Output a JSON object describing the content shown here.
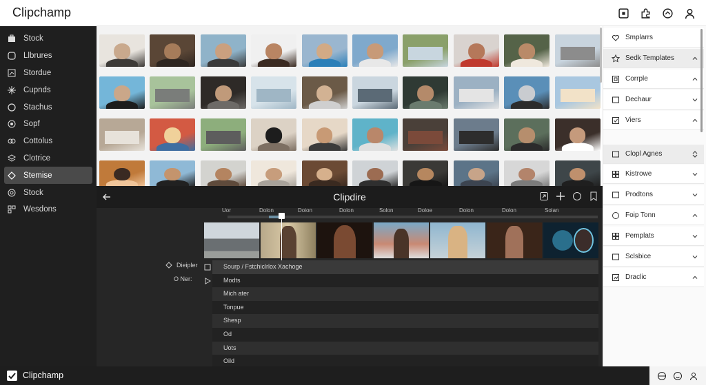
{
  "app": {
    "title": "Clipchamp"
  },
  "topbar": {
    "icons": [
      "media-square-icon",
      "puzzle-icon",
      "refresh-icon",
      "user-icon"
    ]
  },
  "sidebar": {
    "items": [
      {
        "label": "Stock",
        "icon": "briefcase-icon",
        "active": false
      },
      {
        "label": "Llbrures",
        "icon": "square-outline-icon",
        "active": false
      },
      {
        "label": "Stordue",
        "icon": "chart-icon",
        "active": false
      },
      {
        "label": "Cupnds",
        "icon": "sparkle-icon",
        "active": false
      },
      {
        "label": "Stachus",
        "icon": "circle-icon",
        "active": false
      },
      {
        "label": "Sopf",
        "icon": "camera-icon",
        "active": false
      },
      {
        "label": "Cottolus",
        "icon": "link-icon",
        "active": false
      },
      {
        "label": "Clotrice",
        "icon": "stack-icon",
        "active": false
      },
      {
        "label": "Stemise",
        "icon": "diamond-icon",
        "active": true
      },
      {
        "label": "Stock",
        "icon": "target-icon",
        "active": false
      },
      {
        "label": "Wesdons",
        "icon": "grid-icon",
        "active": false
      }
    ]
  },
  "editor": {
    "title": "Clipdire",
    "ruler": [
      "Uor",
      "Dolon",
      "Doion",
      "Dolon",
      "Solon",
      "Doloe",
      "Doion",
      "Dolon",
      "Solan"
    ],
    "track_labels": [
      "Dieipler",
      "O Ner:"
    ],
    "tracks": [
      "Sourp / Fstchiclrlox Xachoge",
      "Modts",
      "Mich ater",
      "Tonpue",
      "Shesp",
      "Od",
      "Uots",
      "Oild"
    ]
  },
  "right_panel": {
    "items": [
      {
        "label": "Smplarrs",
        "icon": "heart-icon",
        "chevron": ""
      },
      {
        "label": "Sedk Templates",
        "icon": "star-icon",
        "chevron": "up"
      },
      {
        "label": "Corrple",
        "icon": "frame-icon",
        "chevron": "up"
      },
      {
        "label": "Dechaur",
        "icon": "rect-icon",
        "chevron": "down"
      },
      {
        "label": "Viers",
        "icon": "check-icon",
        "chevron": "up"
      },
      {
        "label": "Clopl Agnes",
        "icon": "rect-icon",
        "chevron": "updown"
      },
      {
        "label": "Kistrowe",
        "icon": "grid-icon",
        "chevron": "down"
      },
      {
        "label": "Prodtons",
        "icon": "rect-icon",
        "chevron": "down"
      },
      {
        "label": "Foip Tonn",
        "icon": "circle-icon",
        "chevron": "up"
      },
      {
        "label": "Pemplats",
        "icon": "grid-icon",
        "chevron": "down"
      },
      {
        "label": "Sclsbice",
        "icon": "rect-icon",
        "chevron": "down"
      },
      {
        "label": "Draclic",
        "icon": "chart-icon",
        "chevron": "up"
      }
    ]
  },
  "bottombar": {
    "title": "Clipchamp"
  },
  "colors": {
    "sidebar_bg": "#1f1f1f",
    "editor_bg": "#262626",
    "accent": "#6b8fa3"
  }
}
